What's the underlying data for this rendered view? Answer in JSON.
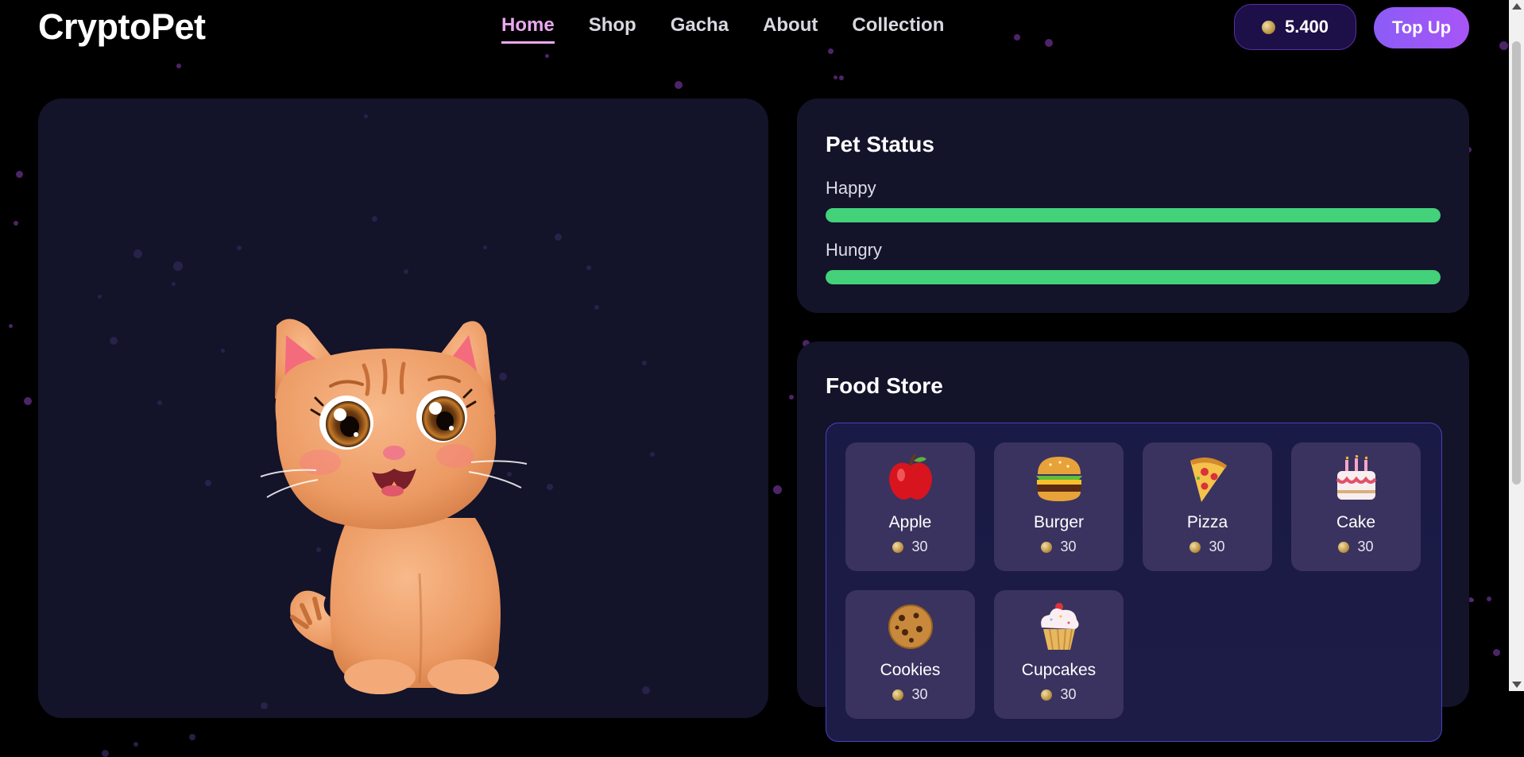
{
  "app": {
    "logo": "CryptoPet"
  },
  "nav": {
    "items": [
      {
        "label": "Home",
        "active": true
      },
      {
        "label": "Shop",
        "active": false
      },
      {
        "label": "Gacha",
        "active": false
      },
      {
        "label": "About",
        "active": false
      },
      {
        "label": "Collection",
        "active": false
      }
    ]
  },
  "wallet": {
    "balance": "5.400",
    "topup_label": "Top Up",
    "coin_icon": "coin-icon"
  },
  "pet_status": {
    "title": "Pet Status",
    "happy": {
      "label": "Happy",
      "fraction": 1.0
    },
    "hungry": {
      "label": "Hungry",
      "fraction": 1.0
    },
    "bar_color": "#43d17a"
  },
  "food_store": {
    "title": "Food Store",
    "items": [
      {
        "name": "Apple",
        "price": "30",
        "icon": "apple-icon"
      },
      {
        "name": "Burger",
        "price": "30",
        "icon": "burger-icon"
      },
      {
        "name": "Pizza",
        "price": "30",
        "icon": "pizza-icon"
      },
      {
        "name": "Cake",
        "price": "30",
        "icon": "cake-icon"
      },
      {
        "name": "Cookies",
        "price": "30",
        "icon": "cookie-icon"
      },
      {
        "name": "Cupcakes",
        "price": "30",
        "icon": "cupcake-icon"
      }
    ]
  },
  "colors": {
    "accent": "#a855f7",
    "active_nav": "#e9a8f0",
    "panel": "#13132a"
  }
}
